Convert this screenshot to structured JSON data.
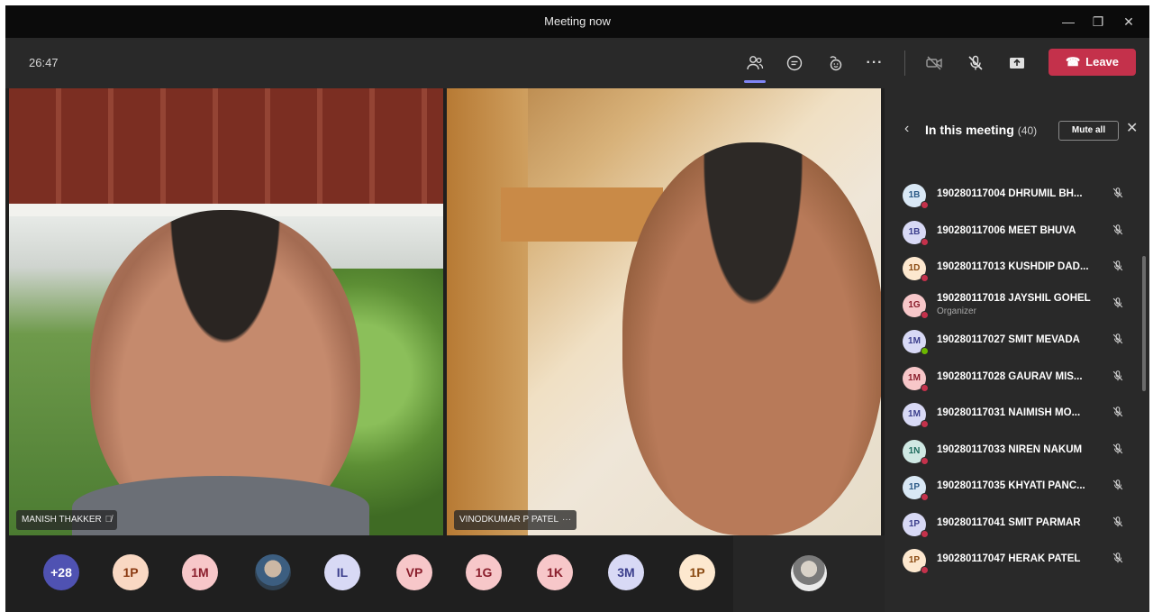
{
  "window": {
    "title": "Meeting now",
    "controls": {
      "minimize": "—",
      "restore": "❐",
      "close": "✕"
    }
  },
  "toolbar": {
    "timer": "26:47",
    "icons": [
      "people-icon",
      "chat-icon",
      "reactions-icon",
      "more-icon",
      "camera-off-icon",
      "mic-off-icon",
      "share-icon"
    ],
    "leave_label": "Leave"
  },
  "videos": [
    {
      "name": "MANISH THAKKER"
    },
    {
      "name": "VINODKUMAR P PATEL"
    }
  ],
  "strip": {
    "avatars": [
      {
        "label": "+28",
        "bg": "#4f52b2",
        "fg": "#ffffff"
      },
      {
        "label": "1P",
        "bg": "#f9d8c3",
        "fg": "#8a3a12"
      },
      {
        "label": "1M",
        "bg": "#f7c7c9",
        "fg": "#8a1e2c"
      },
      {
        "label": "",
        "bg": "#3c5e80",
        "fg": "#ffffff",
        "photo": true
      },
      {
        "label": "IL",
        "bg": "#d8d9f5",
        "fg": "#3b3e8c"
      },
      {
        "label": "VP",
        "bg": "#f7c7c9",
        "fg": "#8a1e2c"
      },
      {
        "label": "1G",
        "bg": "#f7c7c9",
        "fg": "#8a1e2c"
      },
      {
        "label": "1K",
        "bg": "#f7c7c9",
        "fg": "#8a1e2c"
      },
      {
        "label": "3M",
        "bg": "#d8d9f5",
        "fg": "#3b3e8c"
      },
      {
        "label": "1P",
        "bg": "#fde8cf",
        "fg": "#8a4a12"
      }
    ]
  },
  "panel": {
    "title": "In this meeting",
    "count": "(40)",
    "mute_all": "Mute all",
    "participants": [
      {
        "initials": "1B",
        "name": "190280117004 DHRUMIL BH...",
        "role": "",
        "bg": "#d9e8f5",
        "fg": "#2b5a86",
        "status": "#c4314b"
      },
      {
        "initials": "1B",
        "name": "190280117006 MEET BHUVA",
        "role": "",
        "bg": "#d8d9f5",
        "fg": "#3b3e8c",
        "status": "#c4314b"
      },
      {
        "initials": "1D",
        "name": "190280117013 KUSHDIP DAD...",
        "role": "",
        "bg": "#fde8cf",
        "fg": "#8a4a12",
        "status": "#c4314b"
      },
      {
        "initials": "1G",
        "name": "190280117018 JAYSHIL GOHEL",
        "role": "Organizer",
        "bg": "#f7c7c9",
        "fg": "#8a1e2c",
        "status": "#c4314b"
      },
      {
        "initials": "1M",
        "name": "190280117027 SMIT MEVADA",
        "role": "",
        "bg": "#d8d9f5",
        "fg": "#3b3e8c",
        "status": "#6bb700"
      },
      {
        "initials": "1M",
        "name": "190280117028 GAURAV MIS...",
        "role": "",
        "bg": "#f7c7c9",
        "fg": "#8a1e2c",
        "status": "#c4314b"
      },
      {
        "initials": "1M",
        "name": "190280117031 NAIMISH MO...",
        "role": "",
        "bg": "#d8d9f5",
        "fg": "#3b3e8c",
        "status": "#c4314b"
      },
      {
        "initials": "1N",
        "name": "190280117033 NIREN NAKUM",
        "role": "",
        "bg": "#cfe8e3",
        "fg": "#1e6b5e",
        "status": "#c4314b"
      },
      {
        "initials": "1P",
        "name": "190280117035 KHYATI PANC...",
        "role": "",
        "bg": "#d9e8f5",
        "fg": "#2b5a86",
        "status": "#c4314b"
      },
      {
        "initials": "1P",
        "name": "190280117041 SMIT PARMAR",
        "role": "",
        "bg": "#d8d9f5",
        "fg": "#3b3e8c",
        "status": "#c4314b"
      },
      {
        "initials": "1P",
        "name": "190280117047 HERAK PATEL",
        "role": "",
        "bg": "#fde8cf",
        "fg": "#8a4a12",
        "status": "#c4314b"
      }
    ]
  }
}
